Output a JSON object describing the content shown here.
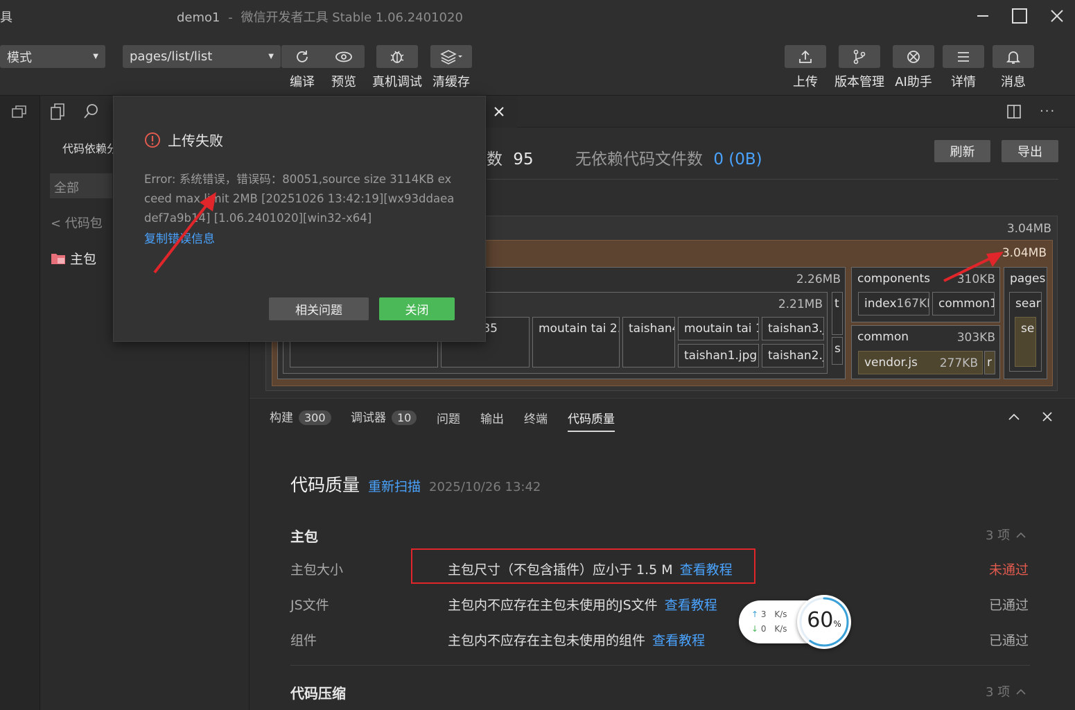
{
  "titlebar": {
    "left_clip": "具",
    "project": "demo1",
    "separator": "-",
    "app_name": "微信开发者工具 Stable 1.06.2401020"
  },
  "toolbar": {
    "mode_select": "模式",
    "page_select": "pages/list/list",
    "buttons": {
      "compile": "编译",
      "preview": "预览",
      "device_debug": "真机调试",
      "clear_cache": "清缓存",
      "upload": "上传",
      "version": "版本管理",
      "ai": "AI助手",
      "details": "详情",
      "messages": "消息"
    }
  },
  "sidebar": {
    "title": "代码依赖分",
    "filter": "全部",
    "back": "< 代码包",
    "item": "主包"
  },
  "analysis": {
    "files_count_label": "数",
    "files_count": "95",
    "unused_label": "无依赖代码文件数",
    "unused_value": "0 (0B)",
    "refresh": "刷新",
    "export": "导出",
    "treemap": {
      "root_size": "3.04MB",
      "main_size": "3.04MB",
      "static_size": "2.26MB",
      "images_size": "2.21MB",
      "img1": "u.jpg385",
      "img2": "moutain tai 2.jp",
      "img3": "taishan4",
      "img4": "moutain tai 1.",
      "img5": "taishan3.jp",
      "img6": "taishan1.jpg1",
      "img7": "taishan2.jp",
      "t_col": "t",
      "s_col": "s",
      "components_name": "components",
      "components_size": "310KB",
      "index_name": "index",
      "index_size": "167KB",
      "common1_name": "common1",
      "common_name": "common",
      "common_size": "303KB",
      "vendor_name": "vendor.js",
      "vendor_size": "277KB",
      "vendor_extra": "r",
      "pages_name": "pages1",
      "search_name": "searc",
      "se_name": "se"
    }
  },
  "bottom": {
    "tabs": [
      {
        "label": "构建",
        "badge": "300"
      },
      {
        "label": "调试器",
        "badge": "10"
      },
      {
        "label": "问题"
      },
      {
        "label": "输出"
      },
      {
        "label": "终端"
      },
      {
        "label": "代码质量"
      }
    ],
    "quality": {
      "title": "代码质量",
      "rescan": "重新扫描",
      "time": "2025/10/26 13:42",
      "section1": "主包",
      "section1_count": "3 项",
      "rows": [
        {
          "label": "主包大小",
          "desc": "主包尺寸（不包含插件）应小于 1.5 M",
          "link": "查看教程",
          "status": "未通过"
        },
        {
          "label": "JS文件",
          "desc": "主包内不应存在主包未使用的JS文件",
          "link": "查看教程",
          "status": "已通过"
        },
        {
          "label": "组件",
          "desc": "主包内不应存在主包未使用的组件",
          "link": "查看教程",
          "status": "已通过"
        }
      ],
      "section2": "代码压缩",
      "section2_count": "3 项"
    }
  },
  "dialog": {
    "title": "上传失败",
    "error": "Error: 系统错误，错误码：80051,source size 3114KB exceed max limit 2MB [20251026 13:42:19][wx93ddaeadef7a9b14] [1.06.2401020][win32-x64]",
    "copy_link": "复制错误信息",
    "btn_related": "相关问题",
    "btn_close": "关闭"
  },
  "net_widget": {
    "up": "3",
    "up_unit": "K/s",
    "down": "0",
    "down_unit": "K/s",
    "percent": "60",
    "percent_sign": "%"
  },
  "colors": {
    "accent_blue": "#4aa3ff",
    "close_green": "#4cb959",
    "fail_red": "#e05a4e",
    "annotation_red": "#e0262a"
  }
}
